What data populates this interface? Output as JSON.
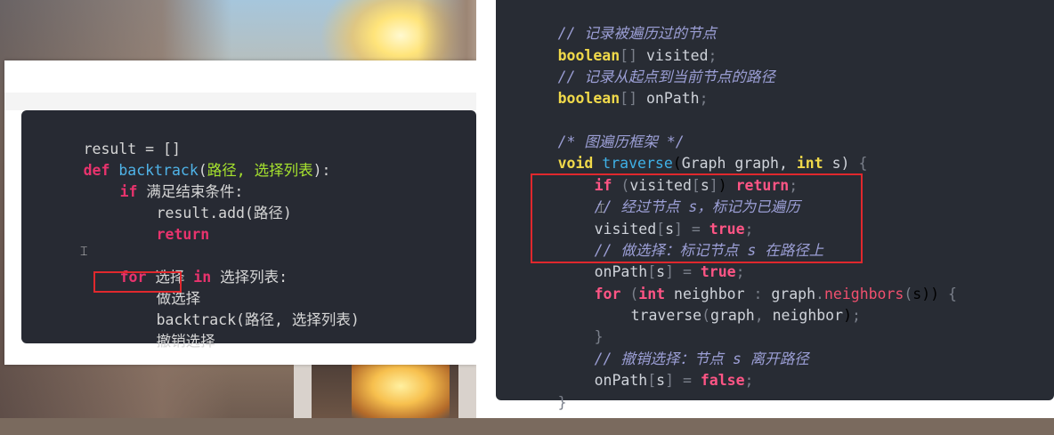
{
  "left_snippet": {
    "lines": [
      "result = []",
      "def backtrack(路径, 选择列表):",
      "if 满足结束条件:",
      "result.add(路径)",
      "return",
      "",
      "for 选择 in 选择列表:",
      "做选择",
      "backtrack(路径, 选择列表)",
      "撤销选择"
    ]
  },
  "right_snippet": {
    "comment_visited": "// 记录被遍历过的节点",
    "decl_visited": "boolean[] visited;",
    "comment_onpath": "// 记录从起点到当前节点的路径",
    "decl_onpath": "boolean[] onPath;",
    "comment_frame": "/* 图遍历框架 */",
    "signature": "void traverse(Graph graph, int s) {",
    "if_visited": "if (visited[s]) return;",
    "comment_mark_visited": "// 经过节点 s，标记为已遍历",
    "assign_visited": "visited[s] = true;",
    "comment_choose": "// 做选择：标记节点 s 在路径上",
    "assign_onpath_true": "onPath[s] = true;",
    "for_neighbors": "for (int neighbor : graph.neighbors(s)) {",
    "recurse_call": "traverse(graph, neighbor);",
    "close_for": "}",
    "comment_undo": "// 撤销选择：节点 s 离开路径",
    "assign_onpath_false": "onPath[s] = false;",
    "close_fn": "}"
  },
  "colors": {
    "editor_bg": "#282c34",
    "keyword_pink": "#e8336d",
    "keyword_yellow": "#f0d94a",
    "function_blue": "#3fb0e6",
    "comment_purple": "#9c9fd6",
    "highlight_box": "#e0282d"
  }
}
